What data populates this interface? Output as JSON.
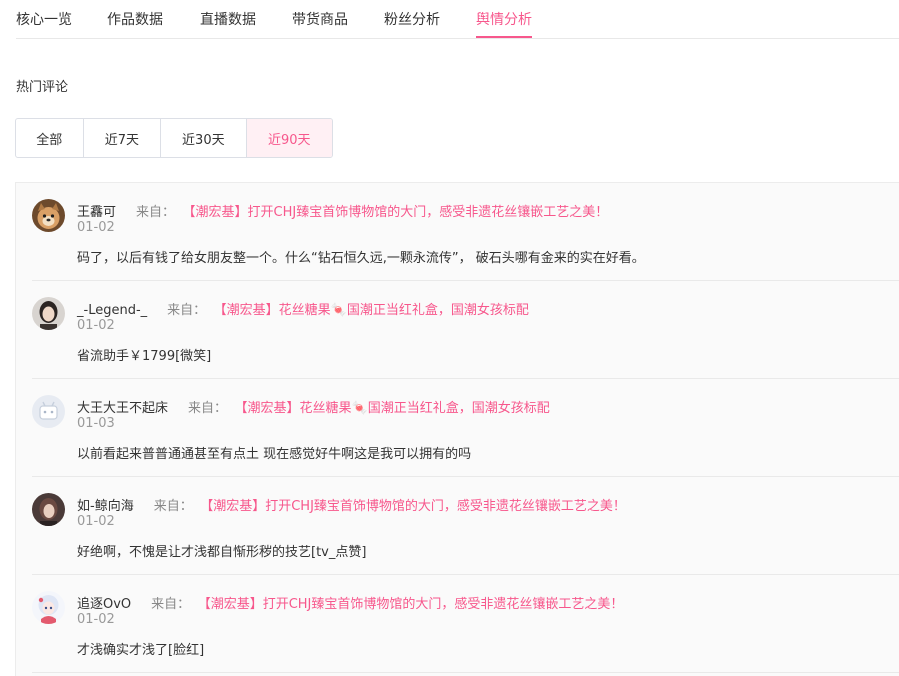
{
  "tabs": [
    "核心一览",
    "作品数据",
    "直播数据",
    "带货商品",
    "粉丝分析",
    "舆情分析"
  ],
  "active_tab": "舆情分析",
  "section_title": "热门评论",
  "filters": [
    "全部",
    "近7天",
    "近30天",
    "近90天"
  ],
  "active_filter": "近90天",
  "from_label": "来自：",
  "comments": [
    {
      "user": "王馫可",
      "title": "【潮宏基】打开CHJ臻宝首饰博物馆的大门，感受非遗花丝镶嵌工艺之美！",
      "date": "01-02",
      "text": "码了，以后有钱了给女朋友整一个。什么“钻石恒久远,一颗永流传”， 破石头哪有金来的实在好看。",
      "avatar": "dog-avatar-icon"
    },
    {
      "user": "_-Legend-_",
      "title": "【潮宏基】花丝糖果🍬国潮正当红礼盒，国潮女孩标配",
      "date": "01-02",
      "text": "省流助手￥1799[微笑]",
      "avatar": "portrait-avatar-icon"
    },
    {
      "user": "大王大王不起床",
      "title": "【潮宏基】花丝糖果🍬国潮正当红礼盒，国潮女孩标配",
      "date": "01-03",
      "text": "以前看起来普普通通甚至有点土 现在感觉好牛啊这是我可以拥有的吗",
      "avatar": "default-avatar-icon"
    },
    {
      "user": "如-鲸向海",
      "title": "【潮宏基】打开CHJ臻宝首饰博物馆的大门，感受非遗花丝镶嵌工艺之美！",
      "date": "01-02",
      "text": "好绝啊，不愧是让才浅都自惭形秽的技艺[tv_点赞]",
      "avatar": "portrait-avatar-icon"
    },
    {
      "user": "追逐OvO",
      "title": "【潮宏基】打开CHJ臻宝首饰博物馆的大门，感受非遗花丝镶嵌工艺之美！",
      "date": "01-02",
      "text": "才浅确实才浅了[脸红]",
      "avatar": "anime-avatar-icon"
    }
  ],
  "colors": {
    "accent": "#f7578c",
    "text": "#333333",
    "muted": "#999999",
    "border": "#e8e8e8",
    "panel": "#fafafa"
  }
}
